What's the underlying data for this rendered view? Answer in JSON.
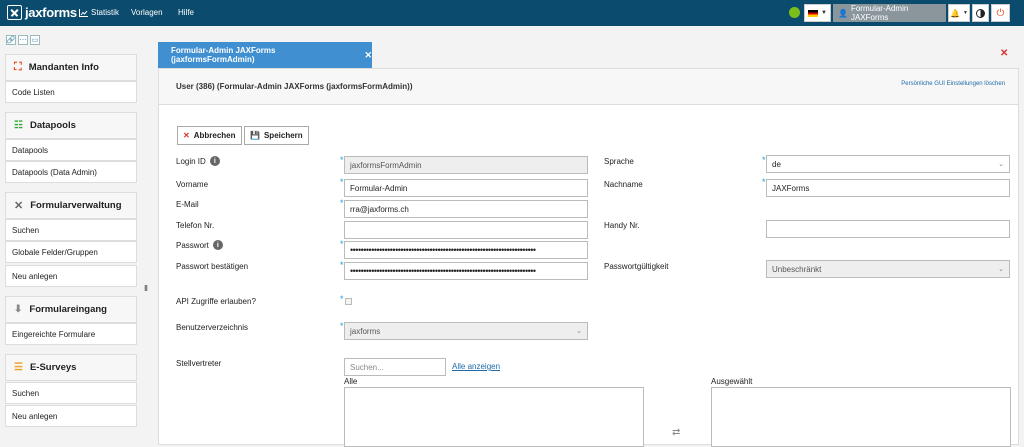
{
  "app": {
    "logo": "jaxforms"
  },
  "topnav": {
    "statistik": "Statistik",
    "vorlagen": "Vorlagen",
    "hilfe": "Hilfe"
  },
  "topright": {
    "user": "Formular-Admin JAXForms",
    "status_color": "#7cbf1a"
  },
  "sidebar": {
    "mandanten": "Mandanten Info",
    "code_listen": "Code Listen",
    "datapools": "Datapools",
    "datapools_item": "Datapools",
    "datapools_admin": "Datapools (Data Admin)",
    "formularverwaltung": "Formularverwaltung",
    "suchen": "Suchen",
    "globale": "Globale Felder/Gruppen",
    "neu": "Neu anlegen",
    "formulareingang": "Formulareingang",
    "eingereichte": "Eingereichte Formulare",
    "esurveys": "E-Surveys",
    "es_suchen": "Suchen",
    "es_neu": "Neu anlegen"
  },
  "tab": {
    "label": "Formular-Admin JAXForms (jaxformsFormAdmin)"
  },
  "panel": {
    "title": "User (386) (Formular-Admin JAXForms (jaxformsFormAdmin))",
    "gui_link": "Persönliche GUI Einstellungen löschen"
  },
  "buttons": {
    "cancel": "Abbrechen",
    "save": "Speichern"
  },
  "form": {
    "login_id_label": "Login ID",
    "login_id": "jaxformsFormAdmin",
    "vorname_label": "Vorname",
    "vorname": "Formular-Admin",
    "email_label": "E-Mail",
    "email": "rra@jaxforms.ch",
    "telefon_label": "Telefon Nr.",
    "telefon": "",
    "passwort_label": "Passwort",
    "passwort": "••••••••••••••••••••••••••••••••••••••••••••••••••••••••••••••••••••••",
    "passwort2_label": "Passwort bestätigen",
    "passwort2": "••••••••••••••••••••••••••••••••••••••••••••••••••••••••••••••••••••••",
    "api_label": "API Zugriffe erlauben?",
    "verzeichnis_label": "Benutzerverzeichnis",
    "verzeichnis": "jaxforms",
    "stellvertreter_label": "Stellvertreter",
    "search_placeholder": "Suchen...",
    "alle_anzeigen": "Alle anzeigen",
    "alle": "Alle",
    "ausgewaehlt": "Ausgewählt",
    "sprache_label": "Sprache",
    "sprache": "de",
    "nachname_label": "Nachname",
    "nachname": "JAXForms",
    "handy_label": "Handy Nr.",
    "handy": "",
    "gueltigkeit_label": "Passwortgültigkeit",
    "gueltigkeit": "Unbeschränkt"
  }
}
